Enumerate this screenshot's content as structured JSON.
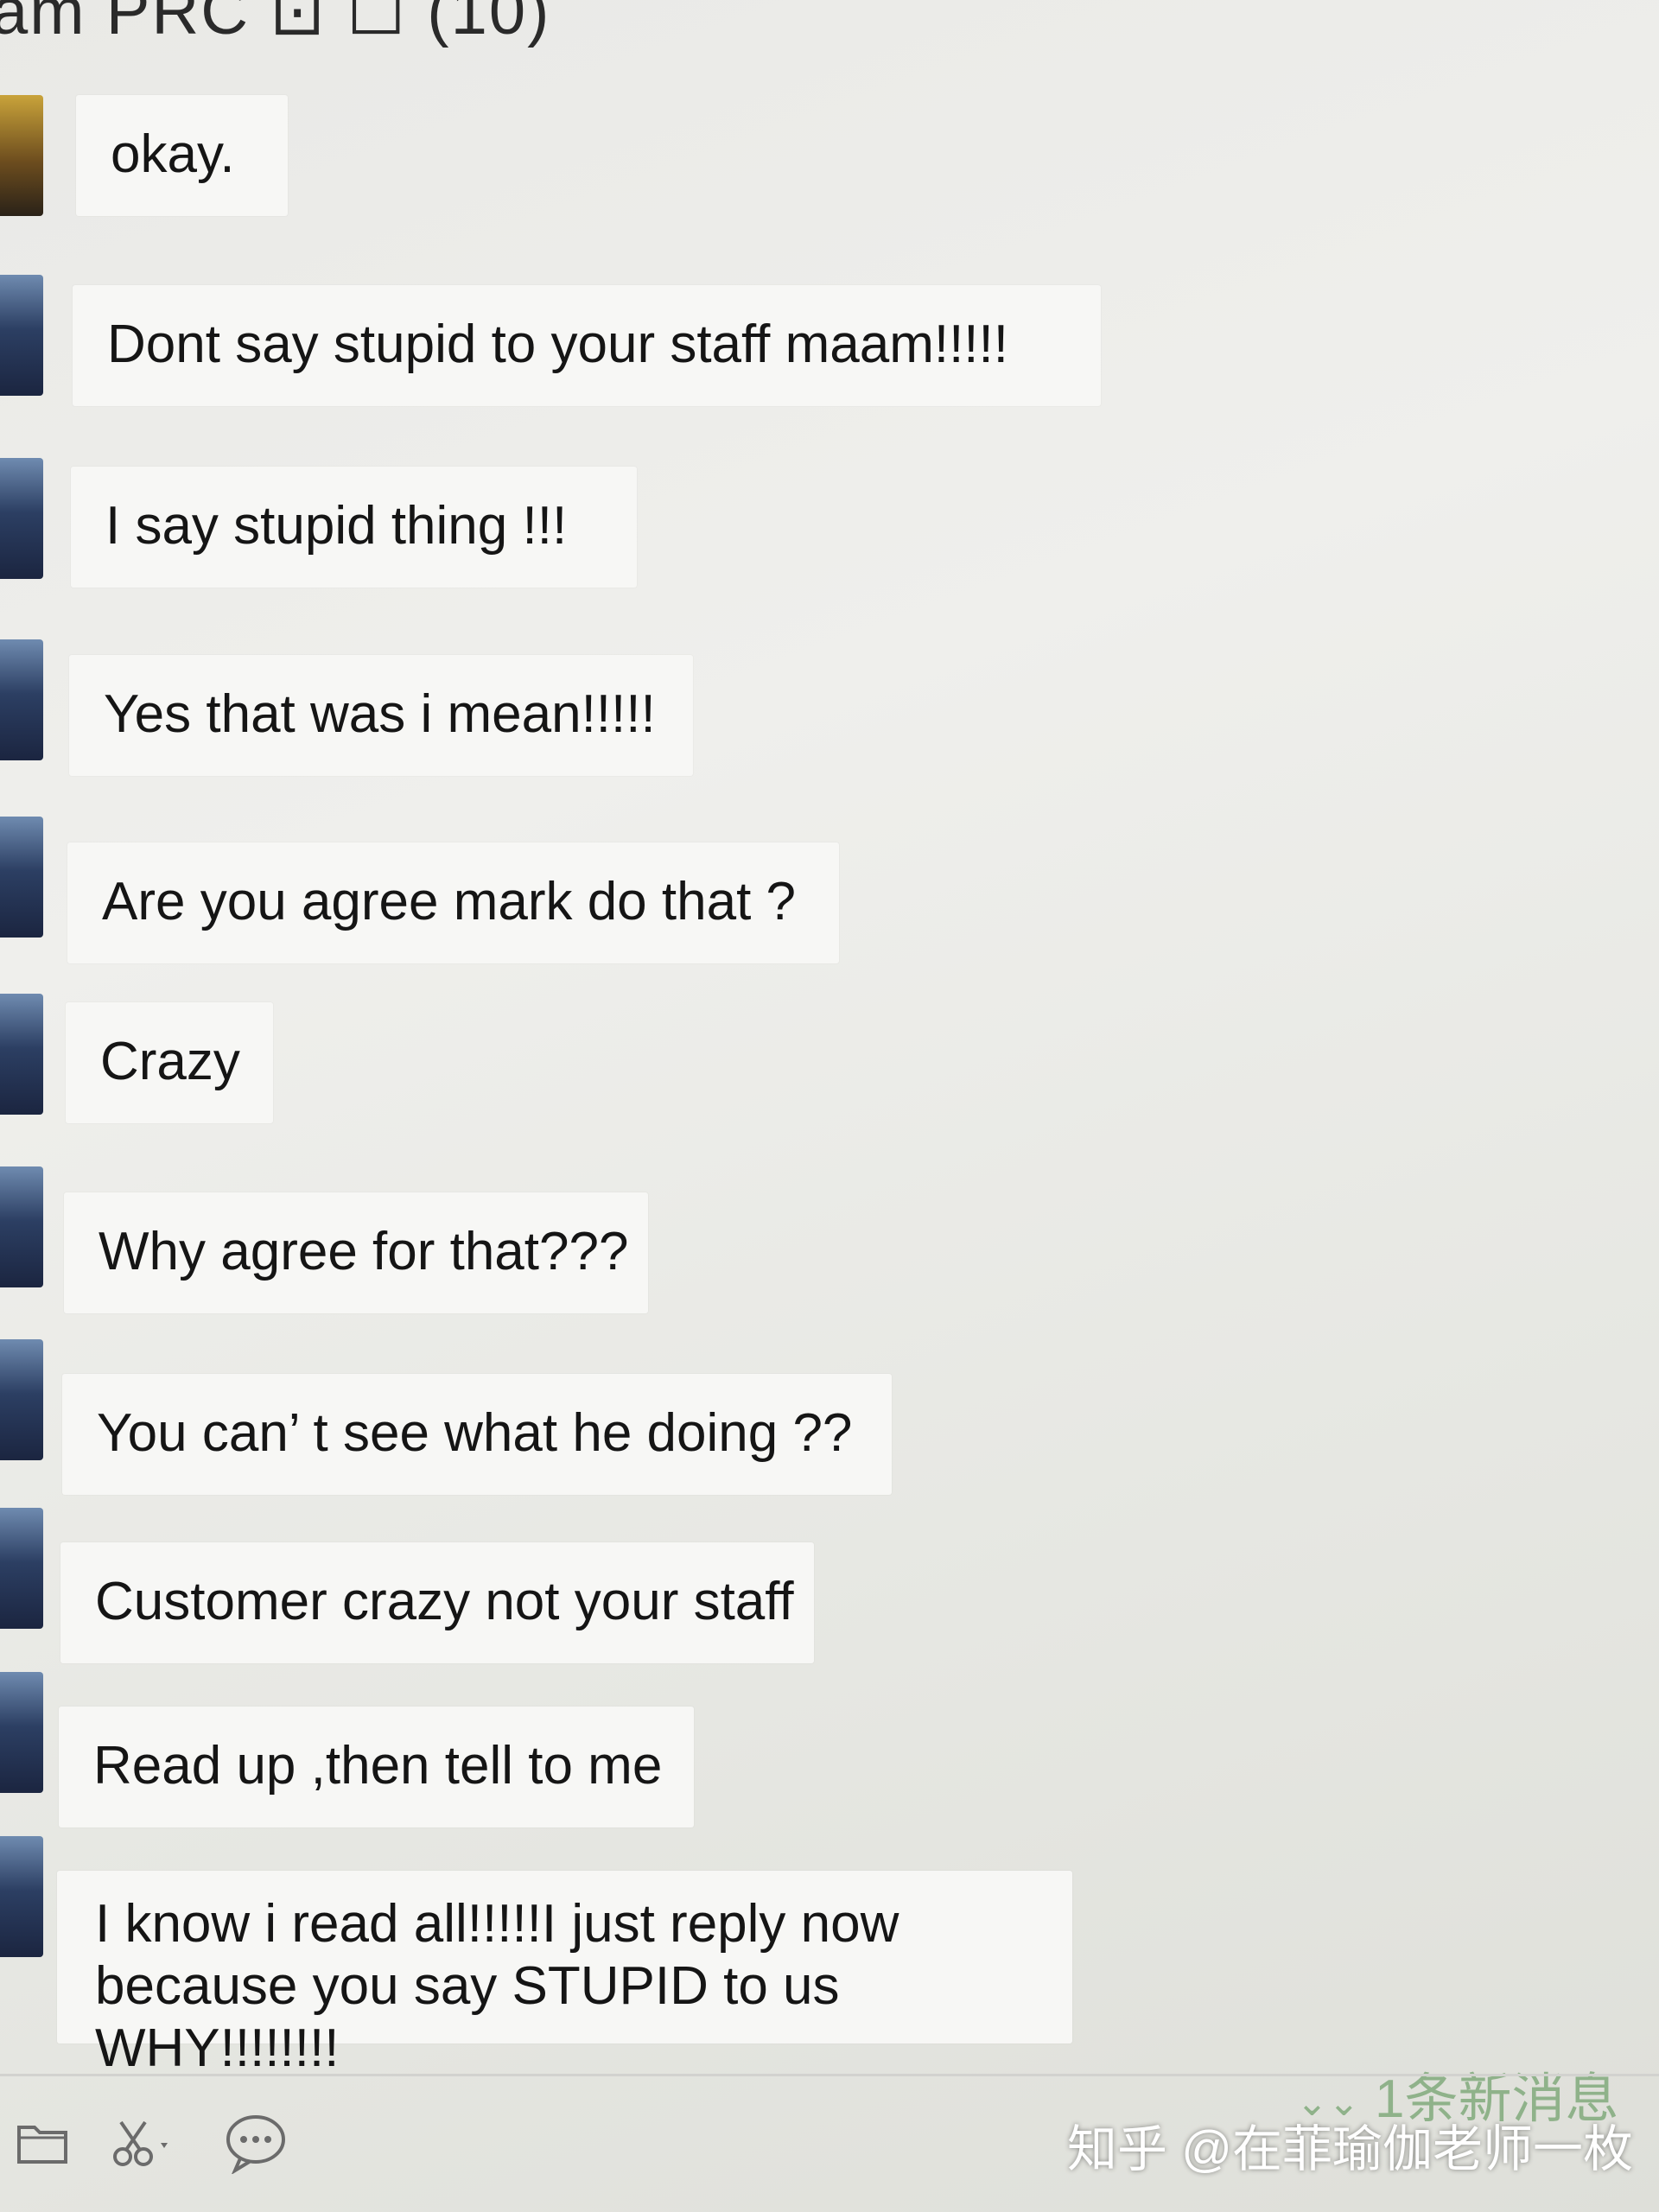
{
  "header": {
    "title": "am PRC ⊡ ☐ (10)"
  },
  "messages": [
    "okay.",
    "Dont say stupid to your staff maam!!!!!",
    "I say stupid thing !!!",
    "Yes that was i mean!!!!!",
    "Are you agree mark do that ?",
    "Crazy",
    "Why agree for that???",
    "You can’  t see what he doing ??",
    "Customer crazy not your staff",
    "Read up ,then tell to me",
    "I know i read all!!!!!I just reply now because you say STUPID to us WHY!!!!!!!!"
  ],
  "toolbar": {
    "folder_icon": "folder-icon",
    "scissors_icon": "scissors-icon",
    "chat_icon": "chat-bubble-icon"
  },
  "notification": {
    "new_message_label": "1条新消息"
  },
  "watermark": {
    "text": "知乎 @在菲瑜伽老师一枚"
  },
  "colors": {
    "bubble": "#f7f7f5",
    "background": "#ececea",
    "new_message": "#8fb28a"
  }
}
